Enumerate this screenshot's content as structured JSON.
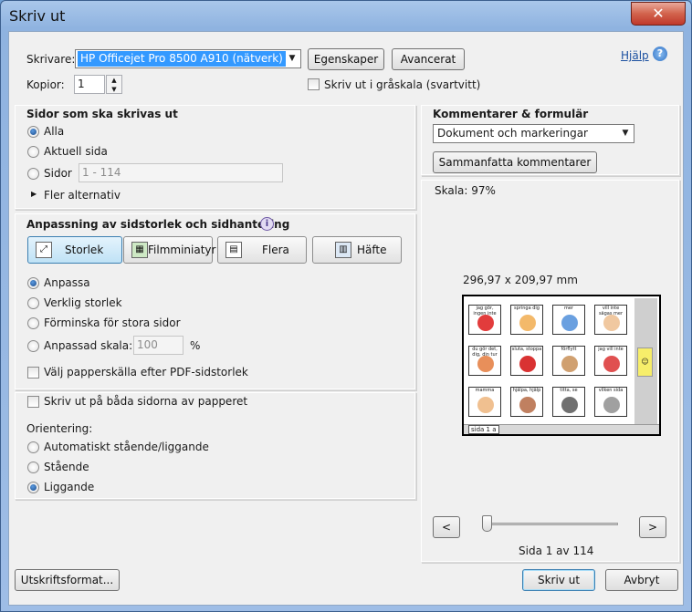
{
  "window": {
    "title": "Skriv ut",
    "close": "✕"
  },
  "printer": {
    "label": "Skrivare:",
    "selected": "HP Officejet Pro 8500 A910 (nätverk)",
    "properties_btn": "Egenskaper",
    "advanced_btn": "Avancerat",
    "help_link": "Hjälp",
    "copies_label": "Kopior:",
    "copies_value": "1",
    "grayscale_label": "Skriv ut i gråskala (svartvitt)"
  },
  "pages": {
    "heading": "Sidor som ska skrivas ut",
    "all": "Alla",
    "current": "Aktuell sida",
    "pages": "Sidor",
    "pages_placeholder": "1 - 114",
    "more": "Fler alternativ"
  },
  "sizing": {
    "heading": "Anpassning av sidstorlek och sidhantering",
    "buttons": [
      "Storlek",
      "Filmminiatyr",
      "Flera",
      "Häfte"
    ],
    "fit": "Anpassa",
    "actual": "Verklig storlek",
    "shrink": "Förminska för stora sidor",
    "custom": "Anpassad skala:",
    "custom_value": "100",
    "percent": "%",
    "paper_source": "Välj papperskälla efter PDF-sidstorlek"
  },
  "duplex": {
    "label": "Skriv ut på båda sidorna av papperet"
  },
  "orientation": {
    "heading": "Orientering:",
    "auto": "Automatiskt stående/liggande",
    "portrait": "Stående",
    "landscape": "Liggande"
  },
  "comments": {
    "heading": "Kommentarer & formulär",
    "selected": "Dokument och markeringar",
    "summarize_btn": "Sammanfatta kommentarer"
  },
  "preview": {
    "scale": "Skala:  97%",
    "dimensions": "296,97 x 209,97 mm",
    "page_label": "sida 1 a",
    "prev": "<",
    "next": ">",
    "page_status": "Sida 1 av 114",
    "cells": [
      "jag gör, ingen inte",
      "springa dig",
      "mer",
      "vill inte sägas mer",
      "du gör det, dig, din tur",
      "sluta, stoppa",
      "förflytt",
      "jag vill inte",
      "mamma",
      "hjälpa, hjälp",
      "titta, se",
      "vilken sida"
    ]
  },
  "footer": {
    "page_setup": "Utskriftsformat...",
    "print": "Skriv ut",
    "cancel": "Avbryt"
  }
}
